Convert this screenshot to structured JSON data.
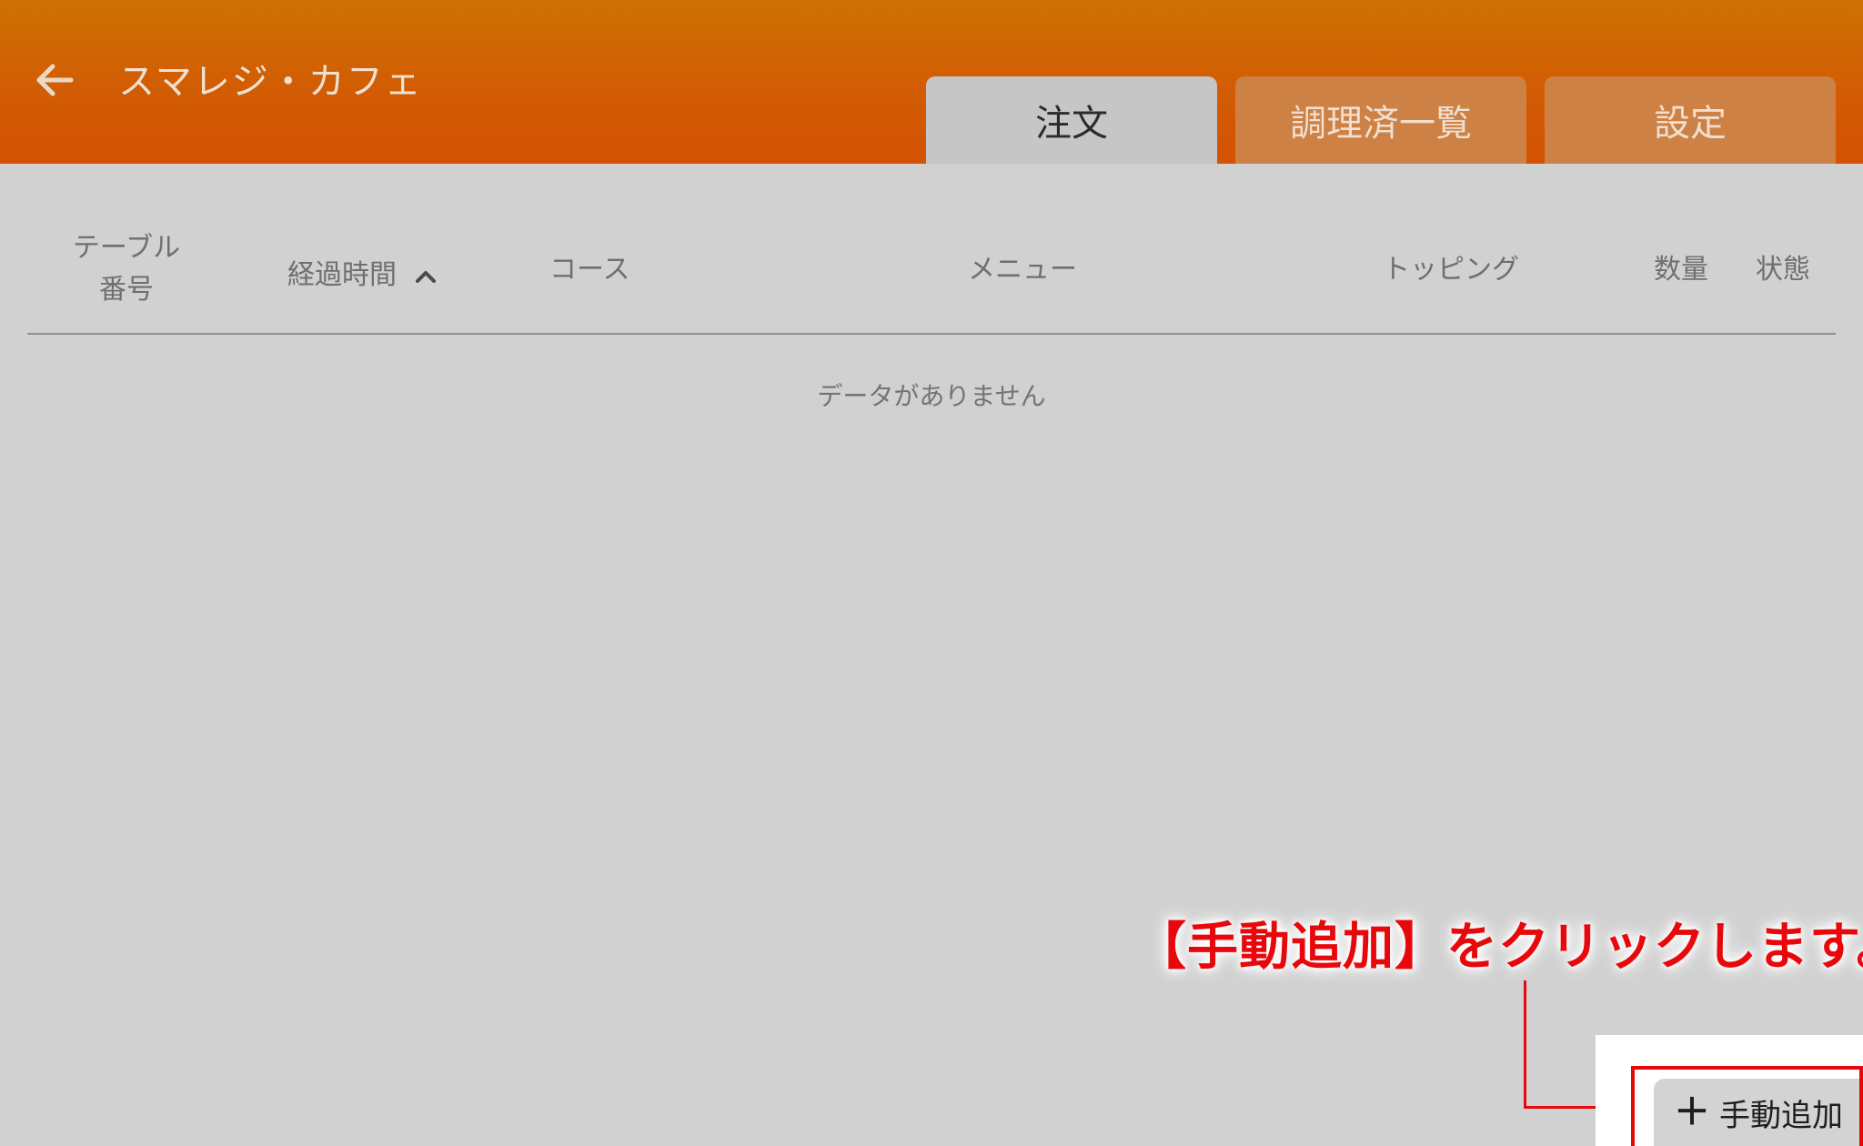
{
  "header": {
    "title": "スマレジ・カフェ",
    "back_icon": "arrow-left-icon",
    "tabs": [
      {
        "label": "注文",
        "active": true
      },
      {
        "label": "調理済一覧",
        "active": false
      },
      {
        "label": "設定",
        "active": false
      }
    ]
  },
  "table": {
    "columns": {
      "table_number_line1": "テーブル",
      "table_number_line2": "番号",
      "elapsed_time": "経過時間",
      "course": "コース",
      "menu": "メニュー",
      "topping": "トッピング",
      "quantity": "数量",
      "status": "状態"
    },
    "sort_icon": "chevron-up-icon",
    "empty_message": "データがありません"
  },
  "manual_add": {
    "icon": "plus-icon",
    "label": "手動追加"
  },
  "annotation": {
    "text": "【手動追加】をクリックします。"
  },
  "colors": {
    "header_top": "#cf7103",
    "header_bottom": "#d35203",
    "background": "#d1d1d1",
    "active_tab": "#c6c6c6",
    "inactive_tab": "#cd8144",
    "annotation_red": "#e8080c"
  }
}
